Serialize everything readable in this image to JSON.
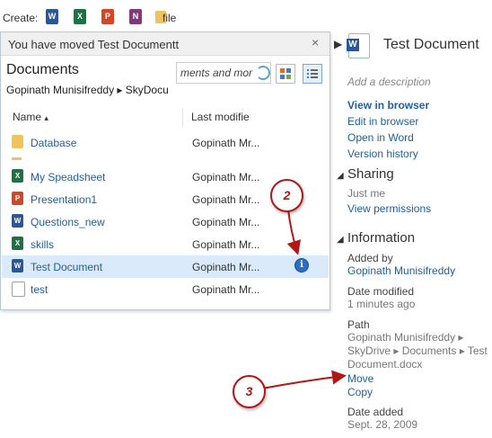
{
  "create": {
    "label": "Create:",
    "icons": [
      {
        "name": "word-icon",
        "glyph": "W",
        "color": "#2b5797"
      },
      {
        "name": "excel-icon",
        "glyph": "X",
        "color": "#1e7145"
      },
      {
        "name": "powerpoint-icon",
        "glyph": "P",
        "color": "#d24726"
      },
      {
        "name": "onenote-icon",
        "glyph": "N",
        "color": "#80397b"
      }
    ],
    "folder_label": "file"
  },
  "notification": {
    "text": "You have moved Test Documentthe",
    "close": "×"
  },
  "browser": {
    "title": "Documents",
    "breadcrumb": "Gopinath Munisifreddy  ▸  SkyDocu",
    "search_value": "ments and mor",
    "columns": {
      "name": "Name",
      "sort_indicator": "▴",
      "modified": "Last modifie"
    },
    "rows": [
      {
        "name": "Database",
        "modified": "Gopinath Mr...",
        "icon": "folder-icon"
      },
      {
        "name": "My Speadsheet",
        "modified": "Gopinath Mr...",
        "icon": "excel-icon"
      },
      {
        "name": "Presentation1",
        "modified": "Gopinath Mr...",
        "icon": "powerpoint-icon"
      },
      {
        "name": "Questions_new",
        "modified": "Gopinath Mr...",
        "icon": "word-icon"
      },
      {
        "name": "skills",
        "modified": "Gopinath Mr...",
        "icon": "excel-icon"
      },
      {
        "name": "Test Document",
        "modified": "Gopinath Mr...",
        "icon": "word-icon",
        "selected": true
      },
      {
        "name": "test",
        "modified": "Gopinath Mr...",
        "icon": "text-file-icon"
      }
    ]
  },
  "callouts": {
    "two": "2",
    "three": "3"
  },
  "details": {
    "title": "Test Document",
    "description_placeholder": "Add a description",
    "actions": [
      "View in browser",
      "Edit in browser",
      "Open in Word",
      "Version history"
    ],
    "sharing": {
      "heading": "Sharing",
      "value": "Just me",
      "link": "View permissions"
    },
    "information": {
      "heading": "Information",
      "added_by_label": "Added by",
      "added_by": "Gopinath Munisifreddy",
      "modified_label": "Date modified",
      "modified": "1 minutes ago",
      "path_label": "Path",
      "path_line1": "Gopinath Munisifreddy ▸",
      "path_line2": "SkyDrive ▸ Documents ▸ Test",
      "path_line3": "Document.docx",
      "move": "Move",
      "copy": "Copy",
      "added_label": "Date added",
      "added": "Sept. 28, 2009"
    }
  },
  "colors": {
    "link": "#1f5f9c",
    "callout": "#b31616",
    "selected_row": "#dbeafa"
  }
}
